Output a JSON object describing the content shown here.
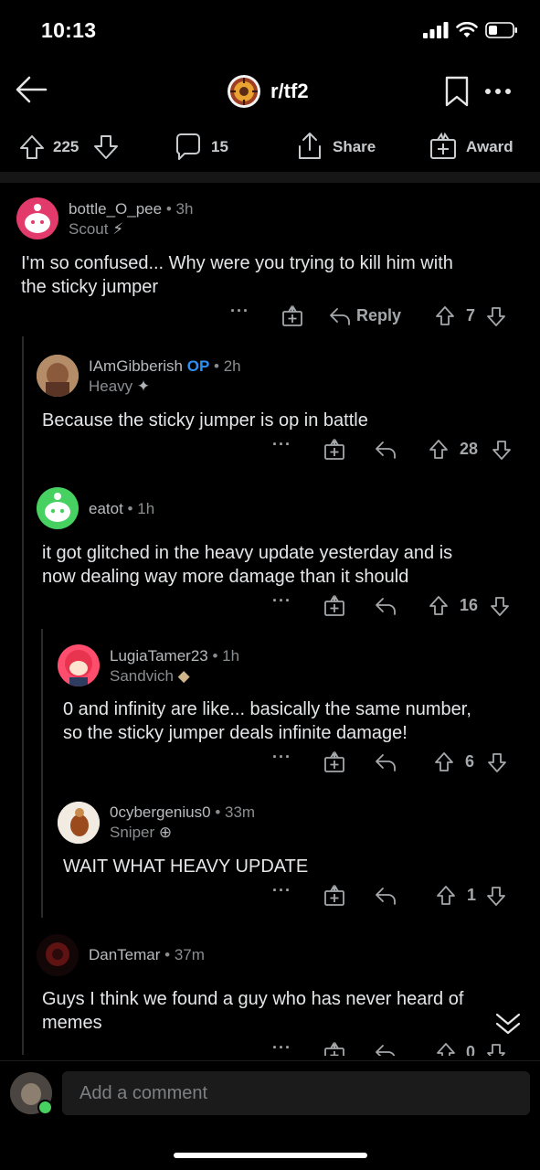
{
  "status": {
    "time": "10:13"
  },
  "header": {
    "subreddit": "r/tf2"
  },
  "post_actions": {
    "upvotes": "225",
    "comments": "15",
    "share": "Share",
    "award": "Award"
  },
  "comments": [
    {
      "user": "bottle_O_pee",
      "age": "3h",
      "flair": "Scout",
      "text_lines": [
        "I'm so confused... Why were you trying to kill him with",
        "the sticky jumper"
      ],
      "reply_label": "Reply",
      "score": "7"
    },
    {
      "user": "IAmGibberish",
      "op": "OP",
      "age": "2h",
      "flair": "Heavy",
      "text_lines": [
        "Because the sticky jumper is op in battle"
      ],
      "score": "28"
    },
    {
      "user": "eatot",
      "age": "1h",
      "flair": "",
      "text_lines": [
        "it got glitched in the heavy update yesterday and is",
        "now dealing way more damage than it should"
      ],
      "score": "16"
    },
    {
      "user": "LugiaTamer23",
      "age": "1h",
      "flair": "Sandvich",
      "text_lines": [
        "0 and infinity are like... basically the same number,",
        "so the sticky jumper deals infinite damage!"
      ],
      "score": "6"
    },
    {
      "user": "0cybergenius0",
      "age": "33m",
      "flair": "Sniper",
      "text_lines": [
        "WAIT WHAT HEAVY UPDATE"
      ],
      "score": "1"
    },
    {
      "user": "DanTemar",
      "age": "37m",
      "flair": "",
      "text_lines": [
        "Guys I think we found a guy who has never heard of",
        "memes"
      ],
      "score": "0"
    }
  ],
  "composer": {
    "placeholder": "Add a comment"
  },
  "colors": {
    "background": "#000000",
    "op_blue": "#2e8ff5",
    "online_green": "#46d160"
  }
}
